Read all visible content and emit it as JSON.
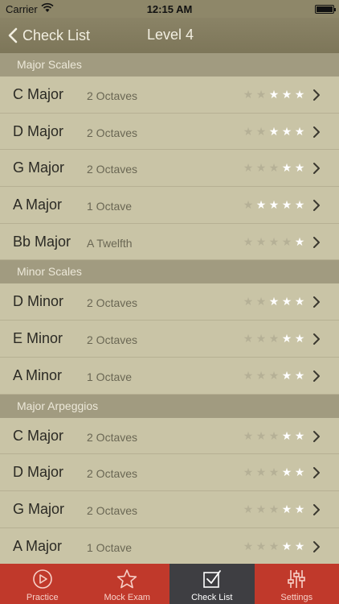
{
  "status": {
    "carrier": "Carrier",
    "time": "12:15 AM"
  },
  "nav": {
    "back_label": "Check List",
    "title": "Level 4"
  },
  "sections": [
    {
      "header": "Major Scales",
      "rows": [
        {
          "name": "C Major",
          "detail": "2 Octaves",
          "rating": 3
        },
        {
          "name": "D Major",
          "detail": "2 Octaves",
          "rating": 3
        },
        {
          "name": "G Major",
          "detail": "2 Octaves",
          "rating": 2
        },
        {
          "name": "A Major",
          "detail": "1 Octave",
          "rating": 4
        },
        {
          "name": "Bb Major",
          "detail": "A Twelfth",
          "rating": 1
        }
      ]
    },
    {
      "header": "Minor Scales",
      "rows": [
        {
          "name": "D Minor",
          "detail": "2 Octaves",
          "rating": 3
        },
        {
          "name": "E Minor",
          "detail": "2 Octaves",
          "rating": 2
        },
        {
          "name": "A Minor",
          "detail": "1 Octave",
          "rating": 2
        }
      ]
    },
    {
      "header": "Major Arpeggios",
      "rows": [
        {
          "name": "C Major",
          "detail": "2 Octaves",
          "rating": 2
        },
        {
          "name": "D Major",
          "detail": "2 Octaves",
          "rating": 2
        },
        {
          "name": "G Major",
          "detail": "2 Octaves",
          "rating": 2
        },
        {
          "name": "A Major",
          "detail": "1 Octave",
          "rating": 2
        }
      ]
    }
  ],
  "rating_max": 5,
  "tabs": [
    {
      "label": "Practice",
      "icon": "play-circle-icon"
    },
    {
      "label": "Mock Exam",
      "icon": "star-outline-icon"
    },
    {
      "label": "Check List",
      "icon": "checkbox-icon"
    },
    {
      "label": "Settings",
      "icon": "sliders-icon"
    }
  ],
  "active_tab": 2,
  "colors": {
    "nav": "#7d7659",
    "section": "#a19b80",
    "row": "#c9c4a6",
    "tab_bar": "#c0392b",
    "tab_active": "#3e3e42"
  }
}
